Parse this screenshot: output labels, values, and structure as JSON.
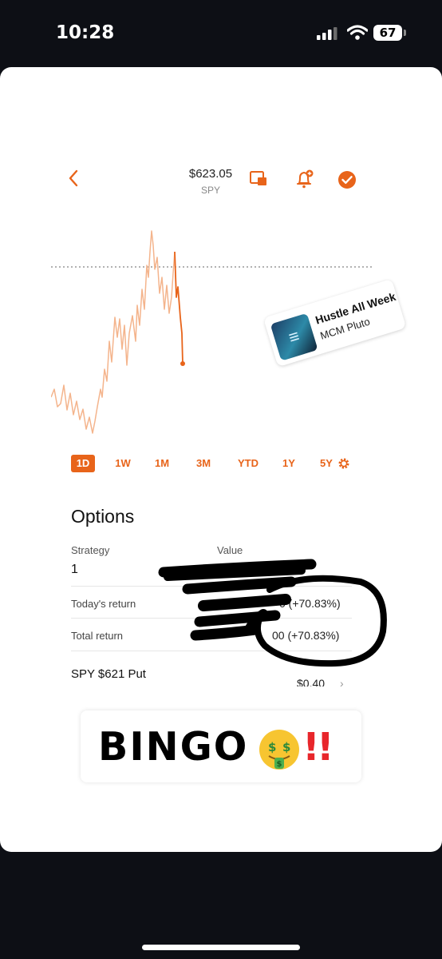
{
  "status_bar": {
    "time": "10:28",
    "battery": "67"
  },
  "app": {
    "price": "$623.05",
    "ticker": "SPY",
    "accent_color": "#e8641a",
    "ranges": [
      "1D",
      "1W",
      "1M",
      "3M",
      "YTD",
      "1Y",
      "5Y"
    ],
    "selected_range": "1D",
    "options": {
      "title": "Options",
      "strategy_label": "Strategy",
      "value_label": "Value",
      "strategy_value": "1",
      "todays_return_label": "Today's return",
      "todays_return_value": "0 (+70.83%)",
      "total_return_label": "Total return",
      "total_return_value": "00 (+70.83%)",
      "contract_label": "SPY $621 Put",
      "contract_value": "$0.40"
    },
    "icons": [
      "back-icon",
      "picture-in-picture-icon",
      "bell-add-icon",
      "check-circle-icon",
      "gear-icon"
    ]
  },
  "music_sticker": {
    "title": "Hustle All Week",
    "artist": "MCM Pluto"
  },
  "caption": {
    "text": "BINGO",
    "emoji_names": [
      "money-mouth-face-icon",
      "double-exclamation-icon"
    ]
  }
}
